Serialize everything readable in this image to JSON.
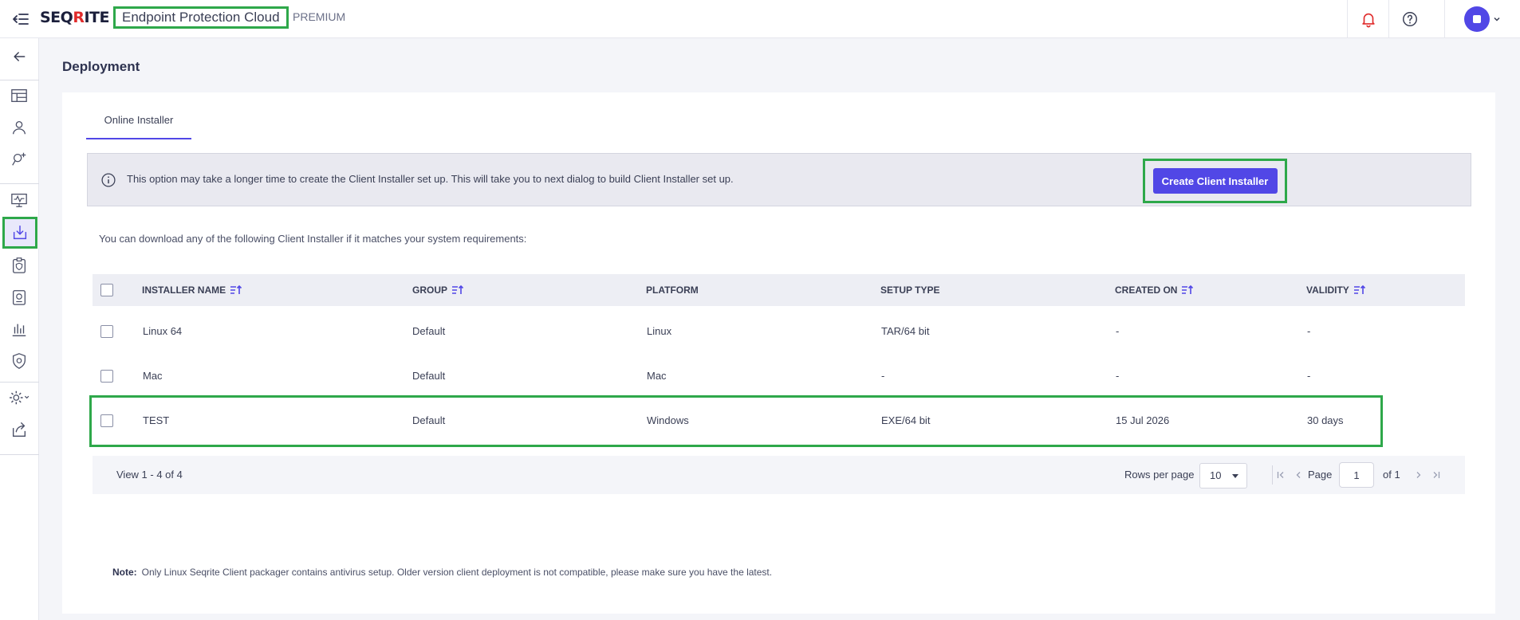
{
  "header": {
    "logo_prefix": "SEQ",
    "logo_accent": "R",
    "logo_suffix": "ITE",
    "product_name": "Endpoint Protection Cloud",
    "edition": "PREMIUM"
  },
  "page": {
    "title": "Deployment"
  },
  "tabs": [
    {
      "label": "Online Installer",
      "active": true
    }
  ],
  "banner": {
    "text": "This option may take a longer time to create the Client Installer set up. This will take you to next dialog to build Client Installer set up.",
    "button_label": "Create Client Installer"
  },
  "hint": "You can download any of the following Client Installer if it matches your system requirements:",
  "table": {
    "columns": {
      "name": "INSTALLER NAME",
      "group": "GROUP",
      "platform": "PLATFORM",
      "setup": "SETUP TYPE",
      "created": "CREATED ON",
      "validity": "VALIDITY"
    },
    "rows": [
      {
        "name": "Linux 64",
        "group": "Default",
        "platform": "Linux",
        "setup": "TAR/64 bit",
        "created": "-",
        "validity": "-"
      },
      {
        "name": "Mac",
        "group": "Default",
        "platform": "Mac",
        "setup": "-",
        "created": "-",
        "validity": "-"
      },
      {
        "name": "TEST",
        "group": "Default",
        "platform": "Windows",
        "setup": "EXE/64 bit",
        "created": "15 Jul 2026",
        "validity": "30 days"
      }
    ]
  },
  "pagination": {
    "view_text": "View 1 - 4 of 4",
    "rows_per_page_label": "Rows per page",
    "rows_per_page": "10",
    "page_label": "Page",
    "page_value": "1",
    "of_text": "of 1"
  },
  "note": {
    "label": "Note:",
    "text": "Only Linux Seqrite Client packager contains antivirus setup.  Older version client deployment is not compatible, please make sure you have the latest."
  },
  "colors": {
    "accent": "#5147e6",
    "highlight": "#2ea84a",
    "bell": "#e02b2b"
  }
}
